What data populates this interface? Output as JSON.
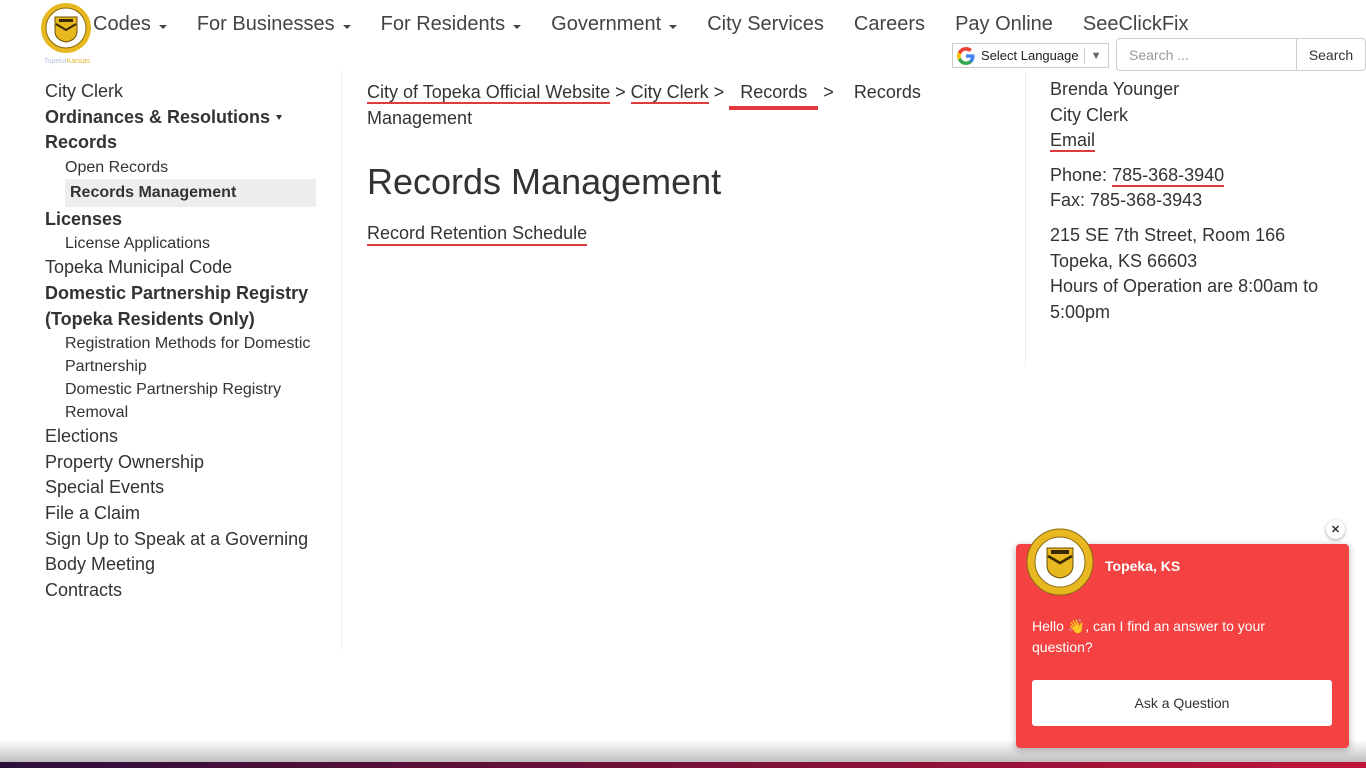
{
  "header": {
    "logo_caption_city": "Topeka",
    "logo_caption_state": "Kansas",
    "nav": [
      {
        "label": "Codes",
        "has_dropdown": true
      },
      {
        "label": "For Businesses",
        "has_dropdown": true
      },
      {
        "label": "For Residents",
        "has_dropdown": true
      },
      {
        "label": "Government",
        "has_dropdown": true
      },
      {
        "label": "City Services",
        "has_dropdown": false
      },
      {
        "label": "Careers",
        "has_dropdown": false
      },
      {
        "label": "Pay Online",
        "has_dropdown": false
      },
      {
        "label": "SeeClickFix",
        "has_dropdown": false
      }
    ],
    "language": {
      "label": "Select Language",
      "arrow": "▼"
    },
    "search": {
      "placeholder": "Search ...",
      "button_label": "Search"
    }
  },
  "sidebar": {
    "items": [
      {
        "label": "City Clerk",
        "level": 1,
        "bold": false
      },
      {
        "label": "Ordinances & Resolutions",
        "level": 1,
        "bold": true,
        "has_dropdown": true
      },
      {
        "label": "Records",
        "level": 1,
        "bold": true
      },
      {
        "label": "Open Records",
        "level": 2
      },
      {
        "label": "Records Management",
        "level": 2,
        "active": true
      },
      {
        "label": "Licenses",
        "level": 1,
        "bold": true
      },
      {
        "label": "License Applications",
        "level": 2
      },
      {
        "label": "Topeka Municipal Code",
        "level": 1,
        "bold": false
      },
      {
        "label": "Domestic Partnership Registry (Topeka Residents Only)",
        "level": 1,
        "bold": true
      },
      {
        "label": "Registration Methods for Domestic Partnership",
        "level": 2
      },
      {
        "label": "Domestic Partnership Registry Removal",
        "level": 2
      },
      {
        "label": "Elections",
        "level": 1,
        "bold": false
      },
      {
        "label": "Property Ownership",
        "level": 1,
        "bold": false
      },
      {
        "label": "Special Events",
        "level": 1,
        "bold": false
      },
      {
        "label": "File a Claim",
        "level": 1,
        "bold": false
      },
      {
        "label": "Sign Up to Speak at a Governing Body Meeting",
        "level": 1,
        "bold": false
      },
      {
        "label": "Contracts",
        "level": 1,
        "bold": false
      }
    ]
  },
  "breadcrumb": {
    "items": [
      "City of Topeka Official Website",
      "City Clerk",
      "Records",
      "Records Management"
    ],
    "separator": ">"
  },
  "main": {
    "title": "Records Management",
    "links": [
      "Record Retention Schedule"
    ]
  },
  "contact": {
    "name": "Brenda Younger",
    "role": "City Clerk",
    "email_label": "Email",
    "phone_label": "Phone:",
    "phone": "785-368-3940",
    "fax_label": "Fax:",
    "fax": "785-368-3943",
    "address_line1": "215 SE 7th Street, Room 166",
    "address_line2": "Topeka, KS 66603",
    "hours": "Hours of Operation are 8:00am to 5:00pm"
  },
  "chat": {
    "title": "Topeka, KS",
    "message_before": "Hello ",
    "wave_emoji": "👋",
    "message_after": ", can I find an answer to your question?",
    "button_label": "Ask a Question",
    "close_symbol": "✕"
  },
  "colors": {
    "accent_red": "#e03a3e",
    "chat_bg": "#f44242",
    "text": "#333333"
  }
}
